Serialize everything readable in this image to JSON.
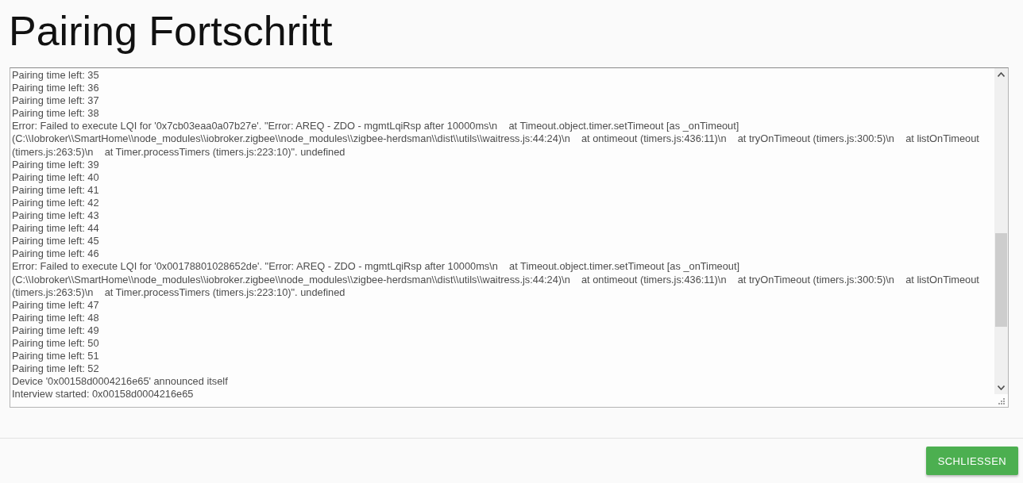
{
  "dialog": {
    "title": "Pairing Fortschritt",
    "log": {
      "lines": [
        "Pairing time left: 35",
        "Pairing time left: 36",
        "Pairing time left: 37",
        "Pairing time left: 38",
        "Error: Failed to execute LQI for '0x7cb03eaa0a07b27e'. \"Error: AREQ - ZDO - mgmtLqiRsp after 10000ms\\n    at Timeout.object.timer.setTimeout [as _onTimeout] (C:\\\\Iobroker\\\\SmartHome\\\\node_modules\\\\iobroker.zigbee\\\\node_modules\\\\zigbee-herdsman\\\\dist\\\\utils\\\\waitress.js:44:24)\\n    at ontimeout (timers.js:436:11)\\n    at tryOnTimeout (timers.js:300:5)\\n    at listOnTimeout (timers.js:263:5)\\n    at Timer.processTimers (timers.js:223:10)\". undefined",
        "Pairing time left: 39",
        "Pairing time left: 40",
        "Pairing time left: 41",
        "Pairing time left: 42",
        "Pairing time left: 43",
        "Pairing time left: 44",
        "Pairing time left: 45",
        "Pairing time left: 46",
        "Error: Failed to execute LQI for '0x00178801028652de'. \"Error: AREQ - ZDO - mgmtLqiRsp after 10000ms\\n    at Timeout.object.timer.setTimeout [as _onTimeout] (C:\\\\Iobroker\\\\SmartHome\\\\node_modules\\\\iobroker.zigbee\\\\node_modules\\\\zigbee-herdsman\\\\dist\\\\utils\\\\waitress.js:44:24)\\n    at ontimeout (timers.js:436:11)\\n    at tryOnTimeout (timers.js:300:5)\\n    at listOnTimeout (timers.js:263:5)\\n    at Timer.processTimers (timers.js:223:10)\". undefined",
        "Pairing time left: 47",
        "Pairing time left: 48",
        "Pairing time left: 49",
        "Pairing time left: 50",
        "Pairing time left: 51",
        "Pairing time left: 52",
        "Device '0x00158d0004216e65' announced itself",
        "Interview started: 0x00158d0004216e65"
      ]
    }
  },
  "buttons": [
    {
      "label": "SCHLIESSEN"
    }
  ]
}
